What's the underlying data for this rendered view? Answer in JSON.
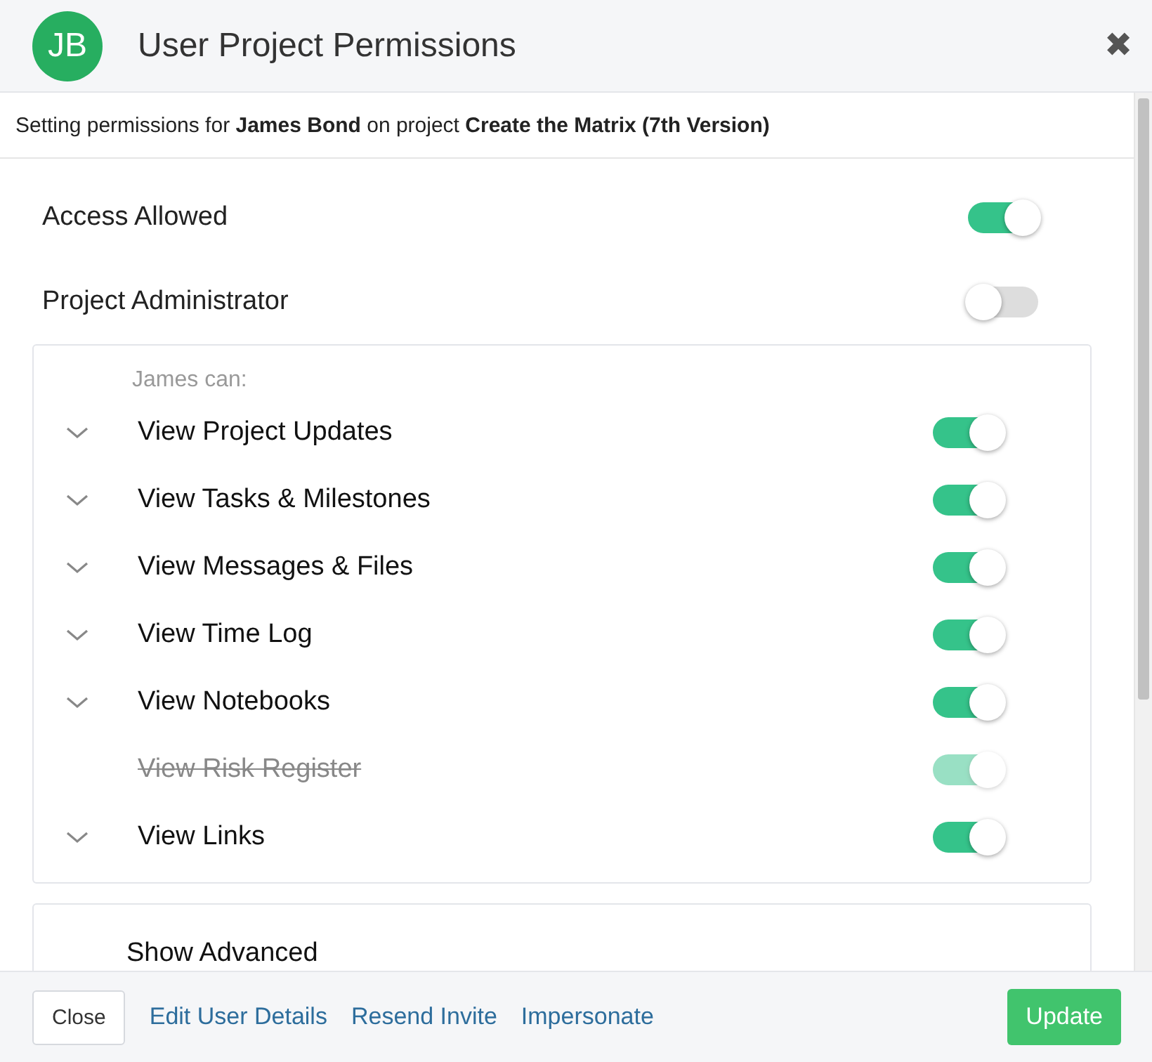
{
  "header": {
    "avatar": "JB",
    "title": "User Project Permissions",
    "close": "✖"
  },
  "intro": "Setting permissions for **James Bond** on project **Create the Matrix (7th Version)**",
  "settings": [
    {
      "label": "Access Allowed",
      "on": true
    },
    {
      "label": "Project Administrator",
      "on": false
    }
  ],
  "permissions": {
    "heading": "James can:",
    "items": [
      {
        "label": "View Project Updates",
        "on": true,
        "disabled": false
      },
      {
        "label": "View Tasks & Milestones",
        "on": true,
        "disabled": false
      },
      {
        "label": "View Messages & Files",
        "on": true,
        "disabled": false
      },
      {
        "label": "View Time Log",
        "on": true,
        "disabled": false
      },
      {
        "label": "View Notebooks",
        "on": true,
        "disabled": false
      },
      {
        "label": "View Risk Register",
        "on": true,
        "disabled": true
      },
      {
        "label": "View Links",
        "on": true,
        "disabled": false
      }
    ]
  },
  "advanced": {
    "label": "Show Advanced"
  },
  "footer": {
    "close": "Close",
    "links": [
      "Edit User Details",
      "Resend Invite",
      "Impersonate"
    ],
    "update": "Update"
  }
}
